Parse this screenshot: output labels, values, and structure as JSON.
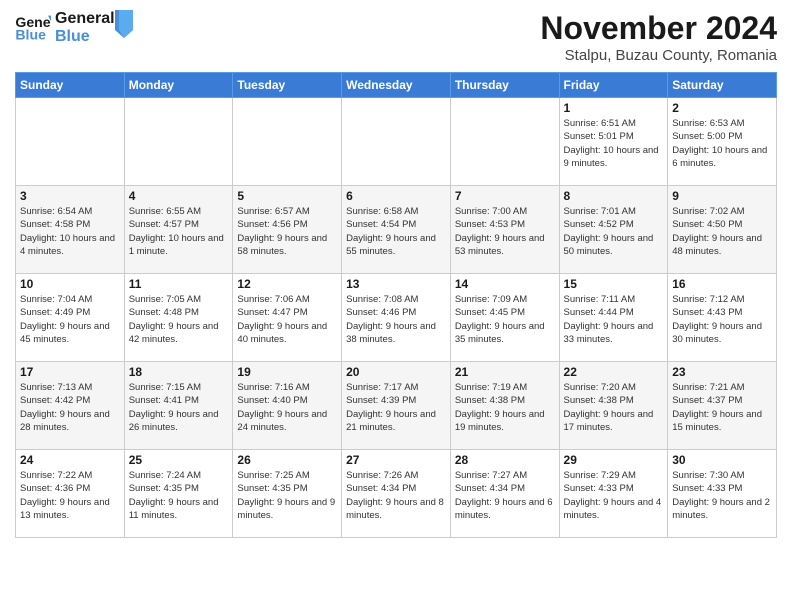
{
  "logo": {
    "line1": "General",
    "line2": "Blue"
  },
  "title": "November 2024",
  "location": "Stalpu, Buzau County, Romania",
  "days_of_week": [
    "Sunday",
    "Monday",
    "Tuesday",
    "Wednesday",
    "Thursday",
    "Friday",
    "Saturday"
  ],
  "weeks": [
    [
      {
        "day": "",
        "info": ""
      },
      {
        "day": "",
        "info": ""
      },
      {
        "day": "",
        "info": ""
      },
      {
        "day": "",
        "info": ""
      },
      {
        "day": "",
        "info": ""
      },
      {
        "day": "1",
        "info": "Sunrise: 6:51 AM\nSunset: 5:01 PM\nDaylight: 10 hours and 9 minutes."
      },
      {
        "day": "2",
        "info": "Sunrise: 6:53 AM\nSunset: 5:00 PM\nDaylight: 10 hours and 6 minutes."
      }
    ],
    [
      {
        "day": "3",
        "info": "Sunrise: 6:54 AM\nSunset: 4:58 PM\nDaylight: 10 hours and 4 minutes."
      },
      {
        "day": "4",
        "info": "Sunrise: 6:55 AM\nSunset: 4:57 PM\nDaylight: 10 hours and 1 minute."
      },
      {
        "day": "5",
        "info": "Sunrise: 6:57 AM\nSunset: 4:56 PM\nDaylight: 9 hours and 58 minutes."
      },
      {
        "day": "6",
        "info": "Sunrise: 6:58 AM\nSunset: 4:54 PM\nDaylight: 9 hours and 55 minutes."
      },
      {
        "day": "7",
        "info": "Sunrise: 7:00 AM\nSunset: 4:53 PM\nDaylight: 9 hours and 53 minutes."
      },
      {
        "day": "8",
        "info": "Sunrise: 7:01 AM\nSunset: 4:52 PM\nDaylight: 9 hours and 50 minutes."
      },
      {
        "day": "9",
        "info": "Sunrise: 7:02 AM\nSunset: 4:50 PM\nDaylight: 9 hours and 48 minutes."
      }
    ],
    [
      {
        "day": "10",
        "info": "Sunrise: 7:04 AM\nSunset: 4:49 PM\nDaylight: 9 hours and 45 minutes."
      },
      {
        "day": "11",
        "info": "Sunrise: 7:05 AM\nSunset: 4:48 PM\nDaylight: 9 hours and 42 minutes."
      },
      {
        "day": "12",
        "info": "Sunrise: 7:06 AM\nSunset: 4:47 PM\nDaylight: 9 hours and 40 minutes."
      },
      {
        "day": "13",
        "info": "Sunrise: 7:08 AM\nSunset: 4:46 PM\nDaylight: 9 hours and 38 minutes."
      },
      {
        "day": "14",
        "info": "Sunrise: 7:09 AM\nSunset: 4:45 PM\nDaylight: 9 hours and 35 minutes."
      },
      {
        "day": "15",
        "info": "Sunrise: 7:11 AM\nSunset: 4:44 PM\nDaylight: 9 hours and 33 minutes."
      },
      {
        "day": "16",
        "info": "Sunrise: 7:12 AM\nSunset: 4:43 PM\nDaylight: 9 hours and 30 minutes."
      }
    ],
    [
      {
        "day": "17",
        "info": "Sunrise: 7:13 AM\nSunset: 4:42 PM\nDaylight: 9 hours and 28 minutes."
      },
      {
        "day": "18",
        "info": "Sunrise: 7:15 AM\nSunset: 4:41 PM\nDaylight: 9 hours and 26 minutes."
      },
      {
        "day": "19",
        "info": "Sunrise: 7:16 AM\nSunset: 4:40 PM\nDaylight: 9 hours and 24 minutes."
      },
      {
        "day": "20",
        "info": "Sunrise: 7:17 AM\nSunset: 4:39 PM\nDaylight: 9 hours and 21 minutes."
      },
      {
        "day": "21",
        "info": "Sunrise: 7:19 AM\nSunset: 4:38 PM\nDaylight: 9 hours and 19 minutes."
      },
      {
        "day": "22",
        "info": "Sunrise: 7:20 AM\nSunset: 4:38 PM\nDaylight: 9 hours and 17 minutes."
      },
      {
        "day": "23",
        "info": "Sunrise: 7:21 AM\nSunset: 4:37 PM\nDaylight: 9 hours and 15 minutes."
      }
    ],
    [
      {
        "day": "24",
        "info": "Sunrise: 7:22 AM\nSunset: 4:36 PM\nDaylight: 9 hours and 13 minutes."
      },
      {
        "day": "25",
        "info": "Sunrise: 7:24 AM\nSunset: 4:35 PM\nDaylight: 9 hours and 11 minutes."
      },
      {
        "day": "26",
        "info": "Sunrise: 7:25 AM\nSunset: 4:35 PM\nDaylight: 9 hours and 9 minutes."
      },
      {
        "day": "27",
        "info": "Sunrise: 7:26 AM\nSunset: 4:34 PM\nDaylight: 9 hours and 8 minutes."
      },
      {
        "day": "28",
        "info": "Sunrise: 7:27 AM\nSunset: 4:34 PM\nDaylight: 9 hours and 6 minutes."
      },
      {
        "day": "29",
        "info": "Sunrise: 7:29 AM\nSunset: 4:33 PM\nDaylight: 9 hours and 4 minutes."
      },
      {
        "day": "30",
        "info": "Sunrise: 7:30 AM\nSunset: 4:33 PM\nDaylight: 9 hours and 2 minutes."
      }
    ]
  ]
}
